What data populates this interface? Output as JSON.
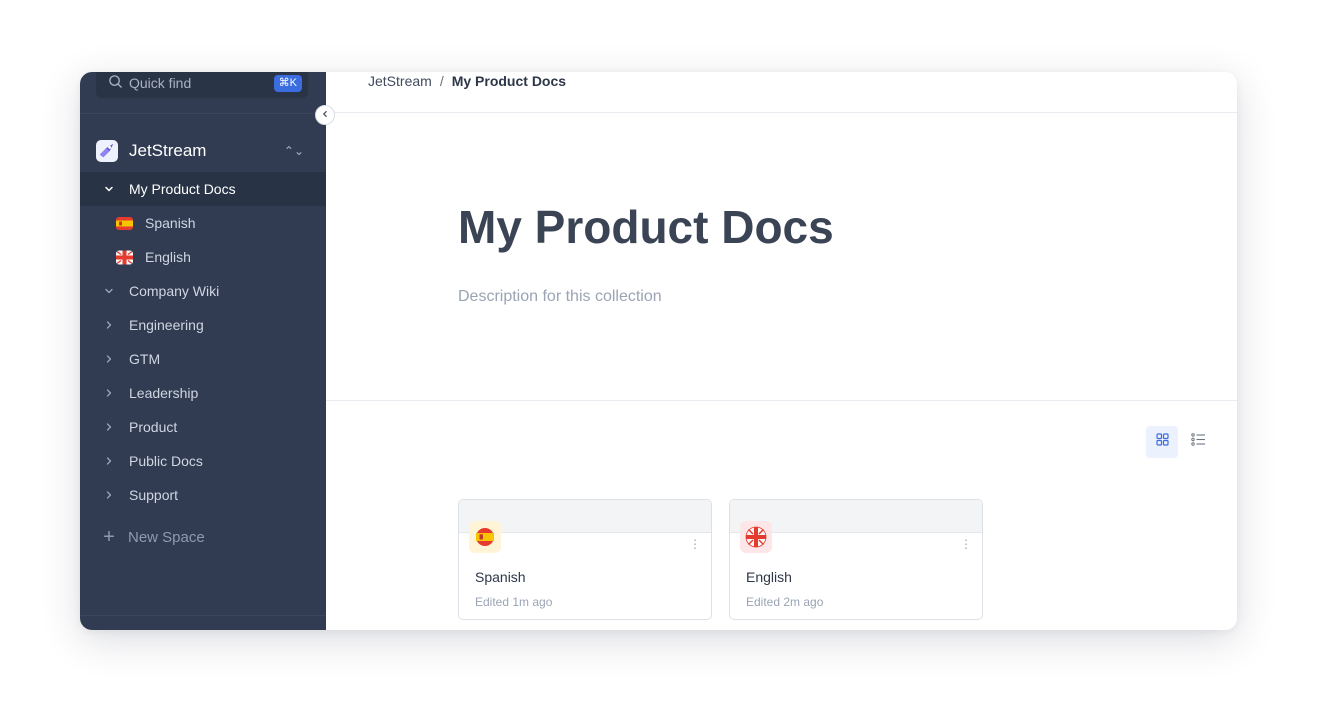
{
  "sidebar": {
    "quick_find": {
      "label": "Quick find",
      "shortcut": "⌘K"
    },
    "workspace": {
      "name": "JetStream"
    },
    "items": [
      {
        "label": "My Product Docs",
        "state": "expanded",
        "active": true
      },
      {
        "label": "Spanish",
        "flag": "spain-flag-icon",
        "child": true
      },
      {
        "label": "English",
        "flag": "uk-flag-icon",
        "child": true
      },
      {
        "label": "Company Wiki",
        "state": "expanded"
      },
      {
        "label": "Engineering",
        "state": "collapsed"
      },
      {
        "label": "GTM",
        "state": "collapsed"
      },
      {
        "label": "Leadership",
        "state": "collapsed"
      },
      {
        "label": "Product",
        "state": "collapsed"
      },
      {
        "label": "Public Docs",
        "state": "collapsed"
      },
      {
        "label": "Support",
        "state": "collapsed"
      }
    ],
    "new_space": "New Space"
  },
  "breadcrumb": {
    "root": "JetStream",
    "separator": "/",
    "current": "My Product Docs"
  },
  "collection": {
    "title": "My Product Docs",
    "description": "Description for this collection"
  },
  "view": {
    "mode": "grid"
  },
  "cards": [
    {
      "title": "Spanish",
      "meta": "Edited 1m ago",
      "icon": "spain-flag-icon"
    },
    {
      "title": "English",
      "meta": "Edited 2m ago",
      "icon": "uk-flag-icon"
    }
  ],
  "colors": {
    "sidebar_bg": "#313c52",
    "accent": "#3c6de0",
    "title": "#3a4454"
  }
}
